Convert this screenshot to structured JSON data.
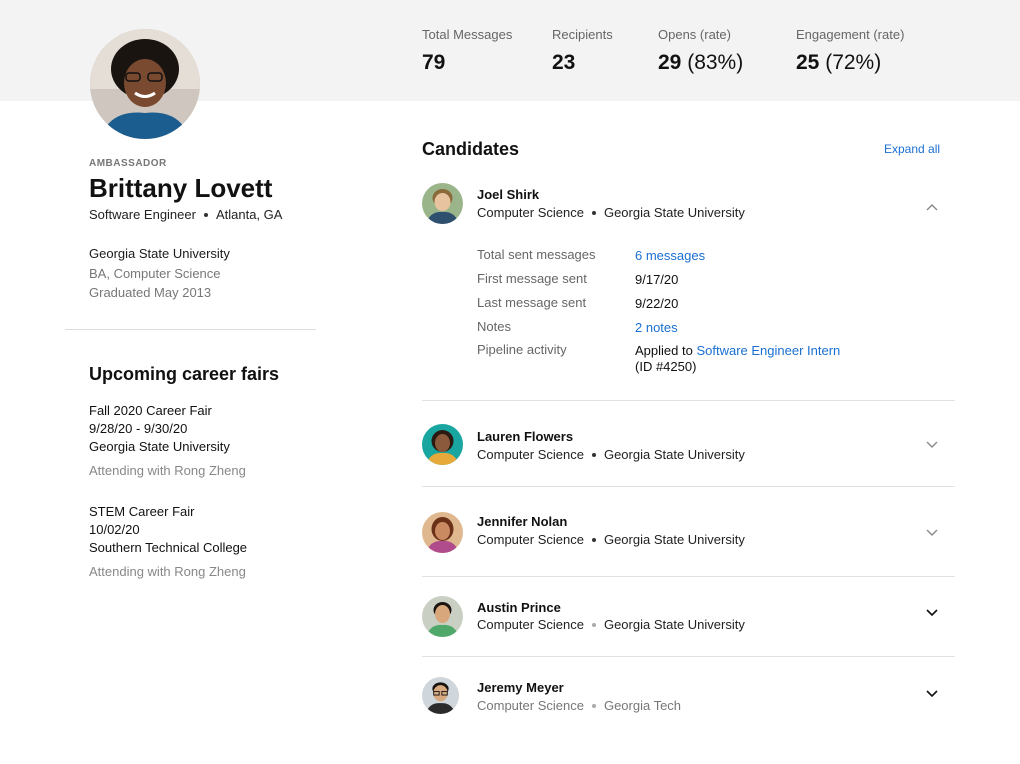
{
  "stats": [
    {
      "label": "Total Messages",
      "value": "79",
      "rate": ""
    },
    {
      "label": "Recipients",
      "value": "23",
      "rate": ""
    },
    {
      "label": "Opens (rate)",
      "value": "29",
      "rate": "(83%)"
    },
    {
      "label": "Engagement (rate)",
      "value": "25",
      "rate": "(72%)"
    }
  ],
  "ambassador": {
    "tag": "AMBASSADOR",
    "name": "Brittany Lovett",
    "title": "Software Engineer",
    "location": "Atlanta, GA",
    "school": "Georgia State University",
    "degree": "BA, Computer Science",
    "graduated": "Graduated May 2013"
  },
  "career_fairs": {
    "title": "Upcoming career fairs",
    "items": [
      {
        "name": "Fall 2020 Career Fair",
        "dates": "9/28/20 - 9/30/20",
        "location": "Georgia State University",
        "attending": "Attending with Rong Zheng"
      },
      {
        "name": "STEM Career Fair",
        "dates": "10/02/20",
        "location": "Southern Technical College",
        "attending": "Attending with Rong Zheng"
      }
    ]
  },
  "candidates": {
    "title": "Candidates",
    "expand_all": "Expand all",
    "items": [
      {
        "name": "Joel Shirk",
        "major": "Computer Science",
        "school": "Georgia State University"
      },
      {
        "name": "Lauren Flowers",
        "major": "Computer Science",
        "school": "Georgia State University"
      },
      {
        "name": "Jennifer Nolan",
        "major": "Computer Science",
        "school": "Georgia State University"
      },
      {
        "name": "Austin Prince",
        "major": "Computer Science",
        "school": "Georgia State University"
      },
      {
        "name": "Jeremy Meyer",
        "major": "Computer Science",
        "school": "Georgia Tech"
      }
    ],
    "detail": {
      "total_label": "Total sent messages",
      "total_value": "6 messages",
      "first_label": "First message sent",
      "first_value": "9/17/20",
      "last_label": "Last message sent",
      "last_value": "9/22/20",
      "notes_label": "Notes",
      "notes_value": "2 notes",
      "pipeline_label": "Pipeline activity",
      "pipeline_prefix": "Applied to",
      "pipeline_job": "Software Engineer Intern",
      "pipeline_id": "(ID #4250)"
    }
  },
  "colors": {
    "accent": "#1a6fd1",
    "band": "#f3f3f4"
  }
}
